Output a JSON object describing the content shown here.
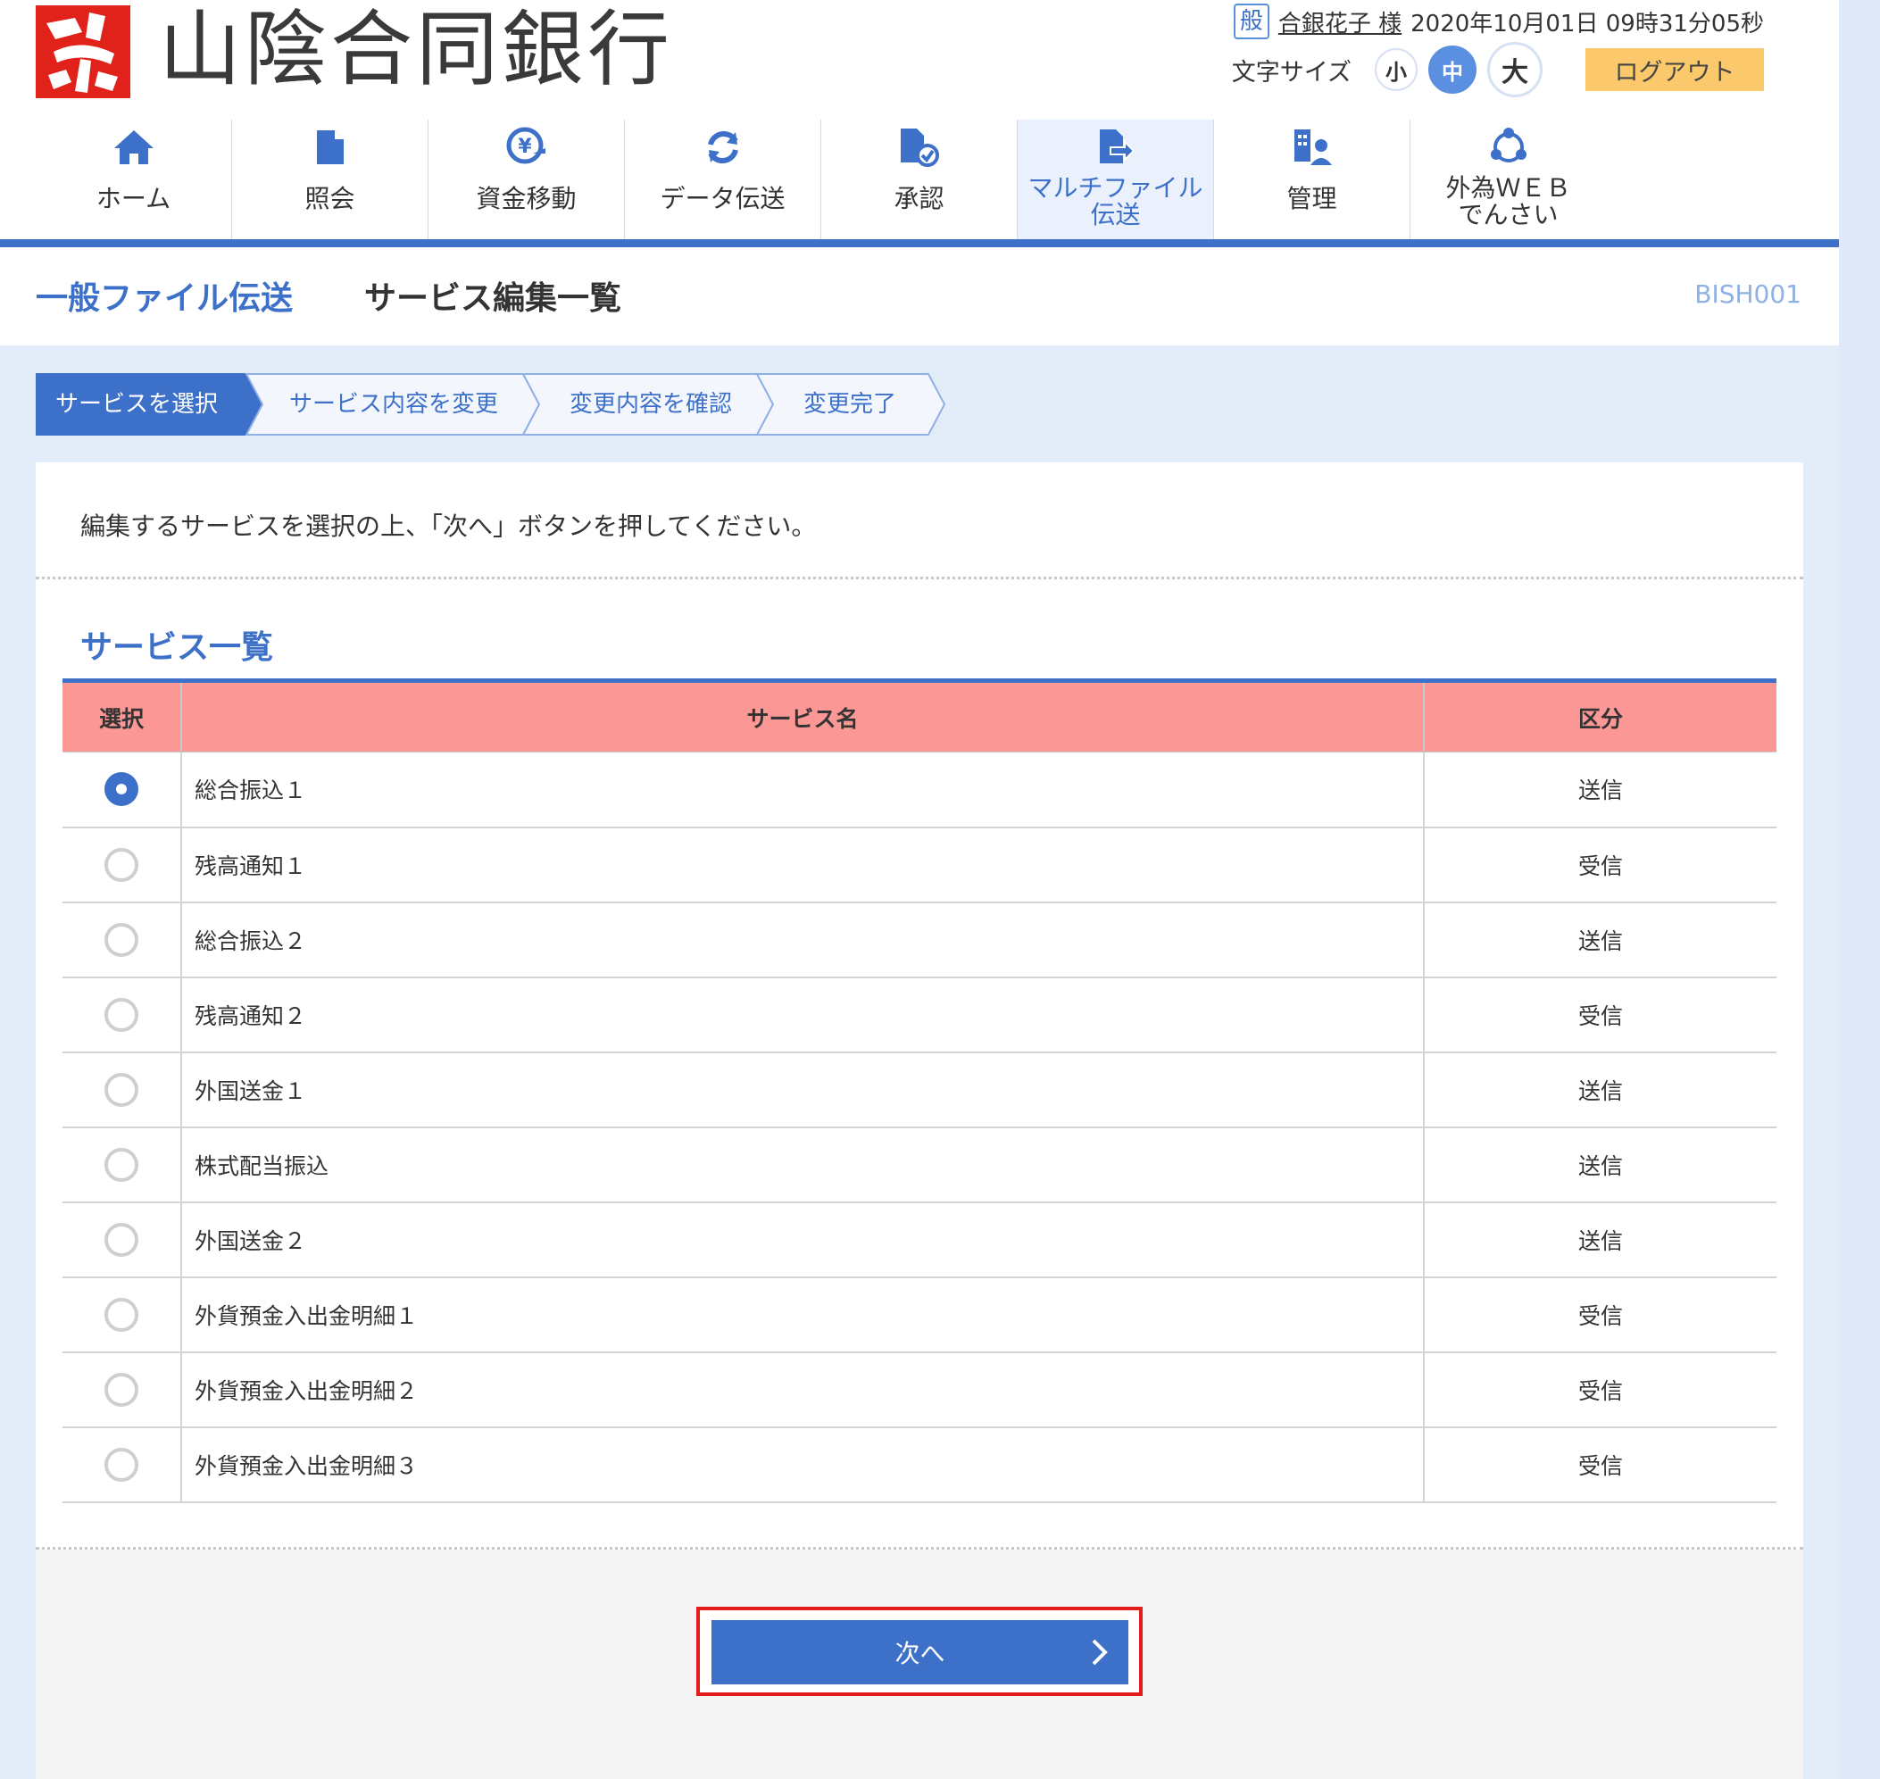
{
  "header": {
    "bank_name": "山陰合同銀行",
    "user_badge": "般",
    "user_name": "合銀花子 様",
    "datetime": "2020年10月01日 09時31分05秒",
    "font_size_label": "文字サイズ",
    "font_sizes": [
      "小",
      "中",
      "大"
    ],
    "font_size_selected": "中",
    "logout_label": "ログアウト"
  },
  "nav": {
    "items": [
      {
        "label": "ホーム",
        "icon": "home-icon"
      },
      {
        "label": "照会",
        "icon": "document-icon"
      },
      {
        "label": "資金移動",
        "icon": "yen-transfer-icon"
      },
      {
        "label": "データ伝送",
        "icon": "refresh-icon"
      },
      {
        "label": "承認",
        "icon": "approve-document-icon"
      },
      {
        "label_line1": "マルチファイル",
        "label_line2": "伝送",
        "icon": "file-transfer-icon",
        "active": true
      },
      {
        "label": "管理",
        "icon": "admin-icon"
      },
      {
        "label_line1": "外為ＷＥＢ",
        "label_line2": "でんさい",
        "icon": "cycle-icon"
      }
    ]
  },
  "page": {
    "title": "一般ファイル伝送",
    "subtitle": "サービス編集一覧",
    "screen_code": "BISH001"
  },
  "steps": [
    "サービスを選択",
    "サービス内容を変更",
    "変更内容を確認",
    "変更完了"
  ],
  "instruction": "編集するサービスを選択の上、「次へ」ボタンを押してください。",
  "section_title": "サービス一覧",
  "table": {
    "headers": [
      "選択",
      "サービス名",
      "区分"
    ],
    "rows": [
      {
        "name": "総合振込１",
        "kbn": "送信",
        "selected": true
      },
      {
        "name": "残高通知１",
        "kbn": "受信",
        "selected": false
      },
      {
        "name": "総合振込２",
        "kbn": "送信",
        "selected": false
      },
      {
        "name": "残高通知２",
        "kbn": "受信",
        "selected": false
      },
      {
        "name": "外国送金１",
        "kbn": "送信",
        "selected": false
      },
      {
        "name": "株式配当振込",
        "kbn": "送信",
        "selected": false
      },
      {
        "name": "外国送金２",
        "kbn": "送信",
        "selected": false
      },
      {
        "name": "外貨預金入出金明細１",
        "kbn": "受信",
        "selected": false
      },
      {
        "name": "外貨預金入出金明細２",
        "kbn": "受信",
        "selected": false
      },
      {
        "name": "外貨預金入出金明細３",
        "kbn": "受信",
        "selected": false
      }
    ]
  },
  "next_button": "次へ",
  "colors": {
    "brand_blue": "#3d70c8",
    "header_pink": "#fb9895",
    "logout_yellow": "#fbc96b",
    "highlight_red": "#e31b1b",
    "logo_red": "#e1221b"
  }
}
